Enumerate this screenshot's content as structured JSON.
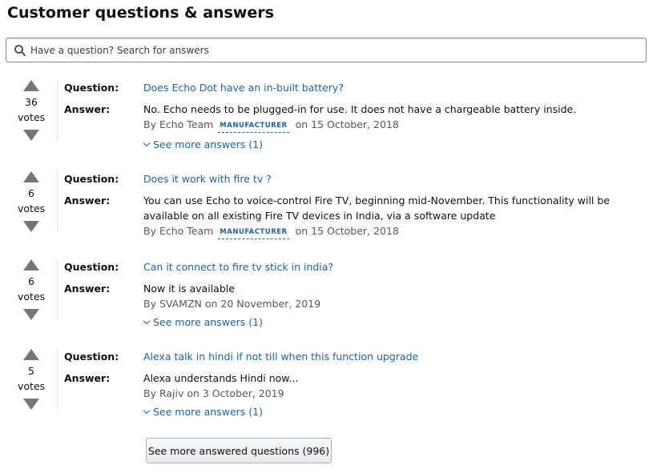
{
  "title": "Customer questions & answers",
  "search": {
    "placeholder": "Have a question? Search for answers"
  },
  "labels": {
    "question": "Question:",
    "answer": "Answer:",
    "votes": "votes"
  },
  "qa": [
    {
      "votes": "36",
      "question": "Does Echo Dot have an in-built battery?",
      "answer": "No. Echo needs to be plugged-in for use. It does not have a chargeable battery inside.",
      "by": "By Echo Team",
      "badge": "MANUFACTURER",
      "date": "on 15 October, 2018",
      "see_more": "See more answers (1)"
    },
    {
      "votes": "6",
      "question": "Does it work with fire tv ?",
      "answer": "You can use Echo to voice-control Fire TV, beginning mid-November. This functionality will be available on all existing Fire TV devices in India, via a software update",
      "by": "By Echo Team",
      "badge": "MANUFACTURER",
      "date": "on 15 October, 2018"
    },
    {
      "votes": "6",
      "question": "Can it connect to fire tv stick in india?",
      "answer": "Now it is available",
      "by": "By SVAMZN on 20 November, 2019",
      "see_more": "See more answers (1)"
    },
    {
      "votes": "5",
      "question": "Alexa talk in hindi if not till when this function upgrade",
      "answer": "Alexa understands Hindi now...",
      "by": "By Rajiv on 3 October, 2019",
      "see_more": "See more answers (1)"
    }
  ],
  "more_button": "See more answered questions (996)",
  "colors": {
    "link": "#2162a1",
    "text": "#0f1111",
    "muted": "#565959",
    "vote_arrow": "#767676"
  }
}
